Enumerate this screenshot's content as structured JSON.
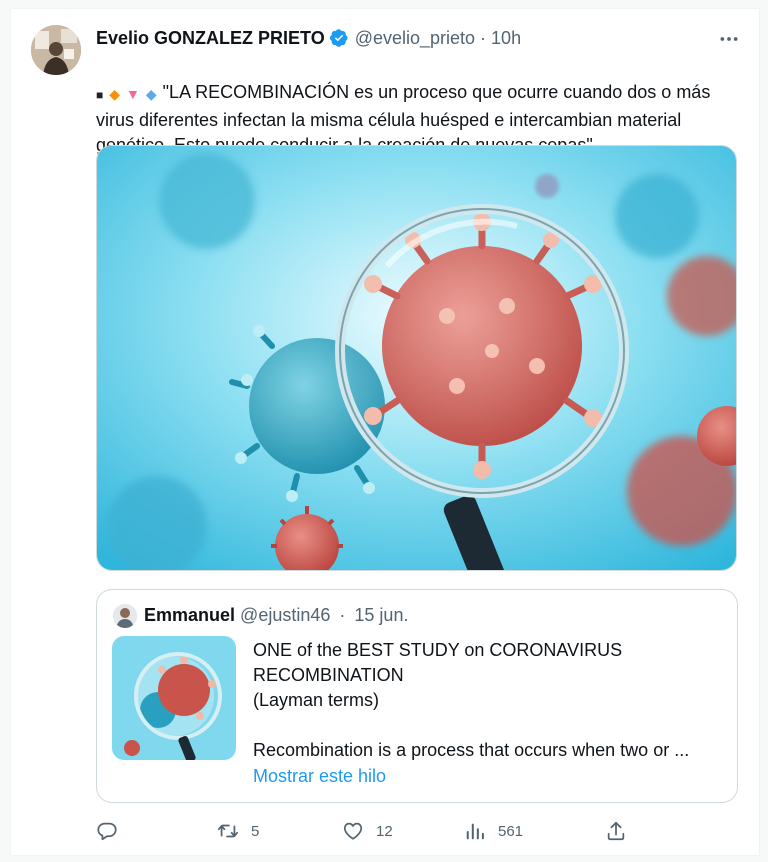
{
  "tweet": {
    "author": {
      "name": "Evelio GONZALEZ PRIETO",
      "handle": "@evelio_prieto",
      "separator": "·",
      "time": "10h",
      "avatar_icon": "profile-photo"
    },
    "text_glyphs": [
      "■",
      "◆",
      "▼",
      "◆"
    ],
    "text": "\"LA RECOMBINACIÓN es un proceso que ocurre cuando dos o más virus diferentes infectan la misma célula huésped e intercambian material genético. Esto puede conducir a la creación de nuevas cepas\"",
    "media_icon": "magnifying-glass-virus-illustration",
    "quote": {
      "name": "Emmanuel",
      "handle": "@ejustin46",
      "separator": "·",
      "time": "15 jun.",
      "lines": [
        "ONE of the BEST STUDY on CORONAVIRUS",
        "RECOMBINATION",
        "(Layman terms)",
        "Recombination is a process that occurs when two or ..."
      ],
      "show_thread": "Mostrar este hilo"
    },
    "actions": {
      "reply_count": "",
      "retweet_count": "5",
      "like_count": "12",
      "views_count": "561"
    },
    "colors": {
      "accent": "#1d9bf0",
      "text": "#0f1419",
      "secondary": "#536471",
      "border": "#cfd9de"
    }
  }
}
